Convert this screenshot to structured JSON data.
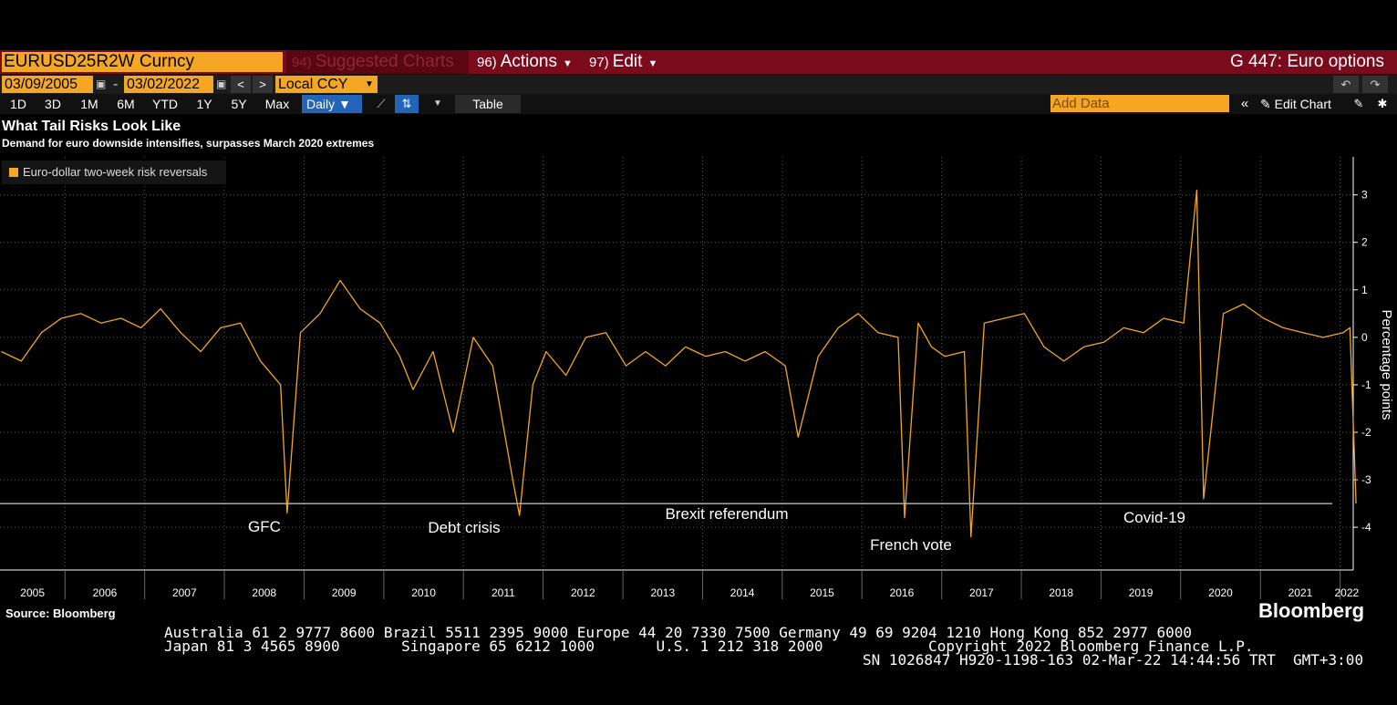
{
  "toolbar": {
    "ticker": "EURUSD25R2W Curncy",
    "suggested": {
      "num": "94)",
      "label": "Suggested Charts"
    },
    "actions": {
      "num": "96)",
      "label": "Actions"
    },
    "edit": {
      "num": "97)",
      "label": "Edit"
    },
    "page_ref": "G 447: Euro options",
    "start_date": "03/09/2005",
    "end_date": "03/02/2022",
    "currency": "Local CCY",
    "ranges": [
      "1D",
      "3D",
      "1M",
      "6M",
      "YTD",
      "1Y",
      "5Y",
      "Max"
    ],
    "frequency": "Daily ▼",
    "table_label": "Table",
    "add_data_placeholder": "Add Data",
    "edit_chart_label": "Edit Chart"
  },
  "chart": {
    "title": "What Tail Risks Look Like",
    "subtitle": "Demand for euro downside intensifies, surpasses March 2020 extremes",
    "legend_label": "Euro-dollar two-week risk reversals",
    "source": "Source: Bloomberg",
    "logo": "Bloomberg"
  },
  "footer": {
    "line1": "Australia 61 2 9777 8600 Brazil 5511 2395 9000 Europe 44 20 7330 7500 Germany 49 69 9204 1210 Hong Kong 852 2977 6000",
    "line2": "Japan 81 3 4565 8900       Singapore 65 6212 1000       U.S. 1 212 318 2000            Copyright 2022 Bloomberg Finance L.P.",
    "line3": "SN 1026847 H920-1198-163 02-Mar-22 14:44:56 TRT  GMT+3:00"
  },
  "colors": {
    "series": "#f5a623",
    "menu_bar": "#7b0a1d",
    "active": "#2364b6"
  },
  "icons": [
    "calendar-icon",
    "chevron-left-icon",
    "chevron-right-icon",
    "undo-icon",
    "redo-icon",
    "line-chart-icon",
    "bar-toggle-icon",
    "collapse-icon",
    "pencil-icon",
    "settings-icon"
  ],
  "chart_data": {
    "type": "line",
    "title": "What Tail Risks Look Like",
    "subtitle": "Demand for euro downside intensifies, surpasses March 2020 extremes",
    "ylabel": "Percentage points",
    "ylim": [
      -4.9,
      3.8
    ],
    "y_ticks": [
      "3",
      "2",
      "1",
      "0",
      "-1",
      "-2",
      "-3",
      "-4"
    ],
    "x_tick_labels": [
      "2005",
      "2006",
      "2007",
      "2008",
      "2009",
      "2010",
      "2011",
      "2012",
      "2013",
      "2014",
      "2015",
      "2016",
      "2017",
      "2018",
      "2019",
      "2020",
      "2021",
      "2022"
    ],
    "x_range": [
      "2005-03-09",
      "2022-03-02"
    ],
    "grid": true,
    "legend": "top-left",
    "threshold_line": -3.5,
    "series": [
      {
        "name": "Euro-dollar two-week risk reversals",
        "color": "#f5a623",
        "x": [
          "2005-03",
          "2005-06",
          "2005-09",
          "2005-12",
          "2006-03",
          "2006-06",
          "2006-09",
          "2006-12",
          "2007-03",
          "2007-06",
          "2007-09",
          "2007-12",
          "2008-03",
          "2008-06",
          "2008-09",
          "2008-10",
          "2008-12",
          "2009-03",
          "2009-06",
          "2009-09",
          "2009-12",
          "2010-03",
          "2010-05",
          "2010-08",
          "2010-11",
          "2011-02",
          "2011-05",
          "2011-08",
          "2011-09",
          "2011-11",
          "2012-01",
          "2012-04",
          "2012-07",
          "2012-10",
          "2013-01",
          "2013-04",
          "2013-07",
          "2013-10",
          "2014-01",
          "2014-04",
          "2014-07",
          "2014-10",
          "2015-01",
          "2015-03",
          "2015-06",
          "2015-09",
          "2015-12",
          "2016-03",
          "2016-06",
          "2016-07",
          "2016-09",
          "2016-11",
          "2017-01",
          "2017-04",
          "2017-05",
          "2017-07",
          "2017-10",
          "2018-01",
          "2018-04",
          "2018-07",
          "2018-10",
          "2019-01",
          "2019-04",
          "2019-07",
          "2019-10",
          "2020-01",
          "2020-03",
          "2020-04",
          "2020-07",
          "2020-10",
          "2021-01",
          "2021-04",
          "2021-07",
          "2021-10",
          "2022-01",
          "2022-02",
          "2022-03"
        ],
        "values": [
          -0.3,
          -0.5,
          0.1,
          0.4,
          0.5,
          0.3,
          0.4,
          0.2,
          0.6,
          0.1,
          -0.3,
          0.2,
          0.3,
          -0.5,
          -1.0,
          -3.7,
          0.1,
          0.5,
          1.2,
          0.6,
          0.3,
          -0.4,
          -1.1,
          -0.3,
          -2.0,
          0.0,
          -0.6,
          -3.0,
          -3.75,
          -1.0,
          -0.3,
          -0.8,
          0.0,
          0.1,
          -0.6,
          -0.3,
          -0.6,
          -0.2,
          -0.4,
          -0.3,
          -0.5,
          -0.3,
          -0.6,
          -2.1,
          -0.4,
          0.2,
          0.5,
          0.1,
          0.0,
          -3.8,
          0.3,
          -0.2,
          -0.4,
          -0.3,
          -4.2,
          0.3,
          0.4,
          0.5,
          -0.2,
          -0.5,
          -0.2,
          -0.1,
          0.2,
          0.1,
          0.4,
          0.3,
          3.1,
          -3.4,
          0.5,
          0.7,
          0.4,
          0.2,
          0.1,
          0.0,
          0.1,
          0.2,
          -3.5
        ]
      }
    ],
    "annotations": [
      "GFC",
      "Debt crisis",
      "Brexit referendum",
      "French vote",
      "Covid-19"
    ]
  }
}
